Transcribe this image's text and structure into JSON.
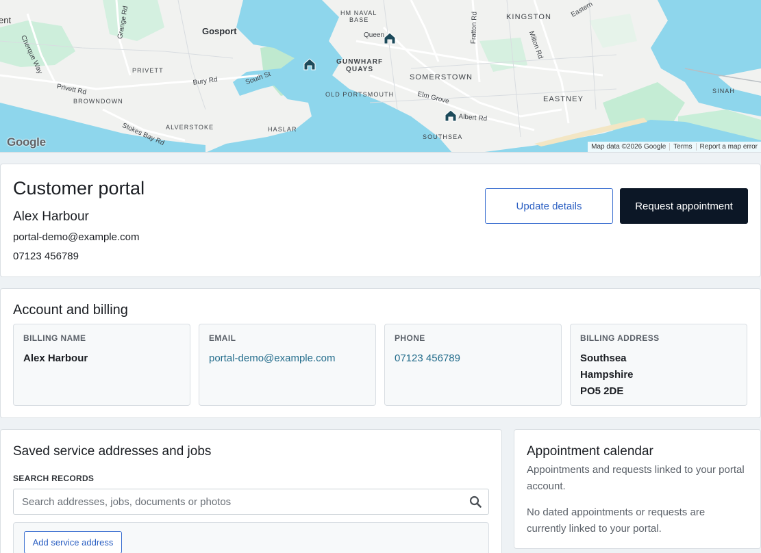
{
  "map": {
    "google_logo": "Google",
    "attribution": [
      "Map data ©2026 Google",
      "Terms",
      "Report a map error"
    ],
    "labels": {
      "ent": "ent",
      "cherque_way": "Cherque Way",
      "grange_rd": "Grange Rd",
      "gosport": "Gosport",
      "hm_naval_1": "HM NAVAL",
      "hm_naval_2": "BASE",
      "queen": "Queen",
      "fratton_rd": "Fratton Rd",
      "kingston": "KINGSTON",
      "milton_rd": "Milton Rd",
      "eastern": "Eastern",
      "privett": "PRIVETT",
      "privett_rd": "Privett Rd",
      "bury_rd": "Bury Rd",
      "south_st": "South St",
      "gunwharf_1": "GUNWHARF",
      "gunwharf_2": "QUAYS",
      "somerstown": "SOMERSTOWN",
      "browndown": "BROWNDOWN",
      "old_portsmouth": "OLD PORTSMOUTH",
      "elm_grove": "Elm Grove",
      "eastney": "EASTNEY",
      "sinah": "SINAH",
      "albert_rd": "Albert Rd",
      "stokes_bay_rd": "Stokes Bay Rd",
      "alverstoke": "ALVERSTOKE",
      "haslar": "HASLAR",
      "southsea": "SOUTHSEA"
    }
  },
  "profile": {
    "title": "Customer portal",
    "name": "Alex Harbour",
    "email": "portal-demo@example.com",
    "phone": "07123 456789",
    "update_button": "Update details",
    "request_button": "Request appointment"
  },
  "billing": {
    "title": "Account and billing",
    "boxes": [
      {
        "label": "BILLING NAME",
        "value": "Alex Harbour"
      },
      {
        "label": "EMAIL",
        "value": "portal-demo@example.com"
      },
      {
        "label": "PHONE",
        "value": "07123 456789"
      },
      {
        "label": "BILLING ADDRESS",
        "lines": [
          "Southsea",
          "Hampshire",
          "PO5 2DE"
        ]
      }
    ]
  },
  "jobs": {
    "title": "Saved service addresses and jobs",
    "search_label": "SEARCH RECORDS",
    "search_placeholder": "Search addresses, jobs, documents or photos",
    "search_value": "",
    "add_button": "Add service address"
  },
  "calendar": {
    "title": "Appointment calendar",
    "description": "Appointments and requests linked to your portal account.",
    "empty_text": "No dated appointments or requests are currently linked to your portal."
  },
  "colors": {
    "water": "#8ed6ec",
    "park": "#c4ecd4",
    "primary_blue": "#2a5ec2",
    "dark_button": "#0c1726",
    "link": "#246d8c",
    "pin": "#1c4a5a"
  }
}
